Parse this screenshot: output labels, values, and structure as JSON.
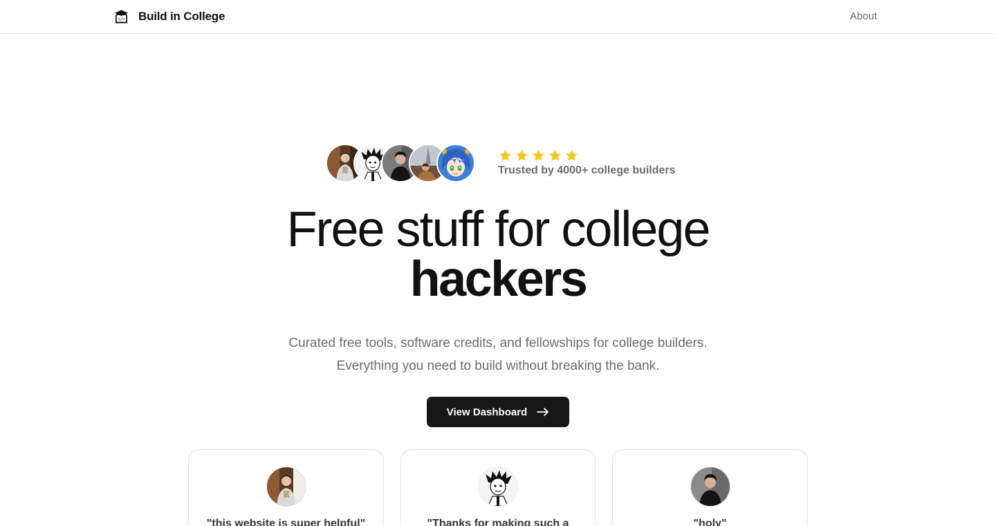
{
  "nav": {
    "brand": "Build in College",
    "about": "About"
  },
  "trust": {
    "rating_stars": 5,
    "text": "Trusted by 4000+ college builders",
    "star_color": "#f5c518"
  },
  "hero": {
    "line1": "Free stuff for college",
    "line2": "hackers"
  },
  "subtitle": {
    "line1": "Curated free tools, software credits, and fellowships for college builders.",
    "line2": "Everything you need to build without breaking the bank."
  },
  "cta": {
    "label": "View Dashboard",
    "icon": "arrow-right-icon"
  },
  "testimonials": [
    {
      "quote": "\"this website is super helpful\""
    },
    {
      "quote": "\"Thanks for making such a"
    },
    {
      "quote": "\"holy\""
    }
  ],
  "colors": {
    "primary_button": "#171717",
    "muted_text": "#6b6b6b",
    "border": "#e6e6e6"
  }
}
